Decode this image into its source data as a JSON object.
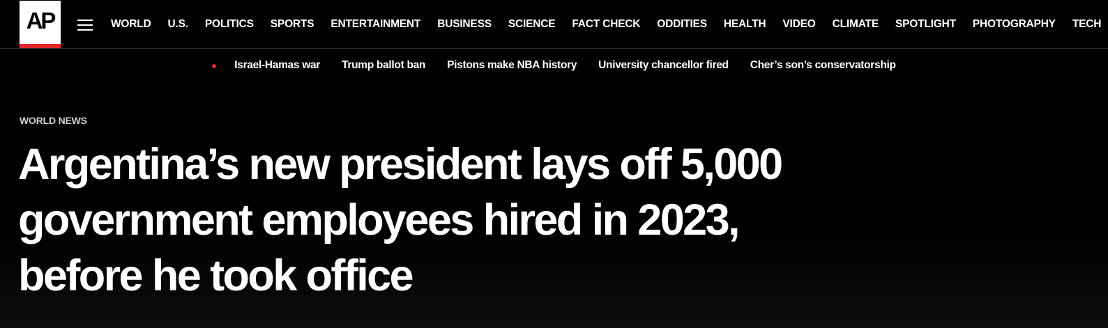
{
  "header": {
    "logo_text": "AP",
    "colors": {
      "background": "#000000",
      "logo_accent": "#e4262d",
      "text": "#ffffff"
    },
    "menu_icon": "hamburger-menu-icon",
    "nav_items": [
      "WORLD",
      "U.S.",
      "POLITICS",
      "SPORTS",
      "ENTERTAINMENT",
      "BUSINESS",
      "SCIENCE",
      "FACT CHECK",
      "ODDITIES",
      "HEALTH",
      "VIDEO",
      "CLIMATE",
      "SPOTLIGHT",
      "PHOTOGRAPHY",
      "TECH"
    ]
  },
  "trending": {
    "indicator_icon": "live-dot-icon",
    "items": [
      "Israel-Hamas war",
      "Trump ballot ban",
      "Pistons make NBA history",
      "University chancellor fired",
      "Cher’s son’s conservatorship"
    ]
  },
  "article": {
    "section": "WORLD NEWS",
    "headline": "Argentina’s new president lays off 5,000 government employees hired in 2023, before he took office"
  }
}
